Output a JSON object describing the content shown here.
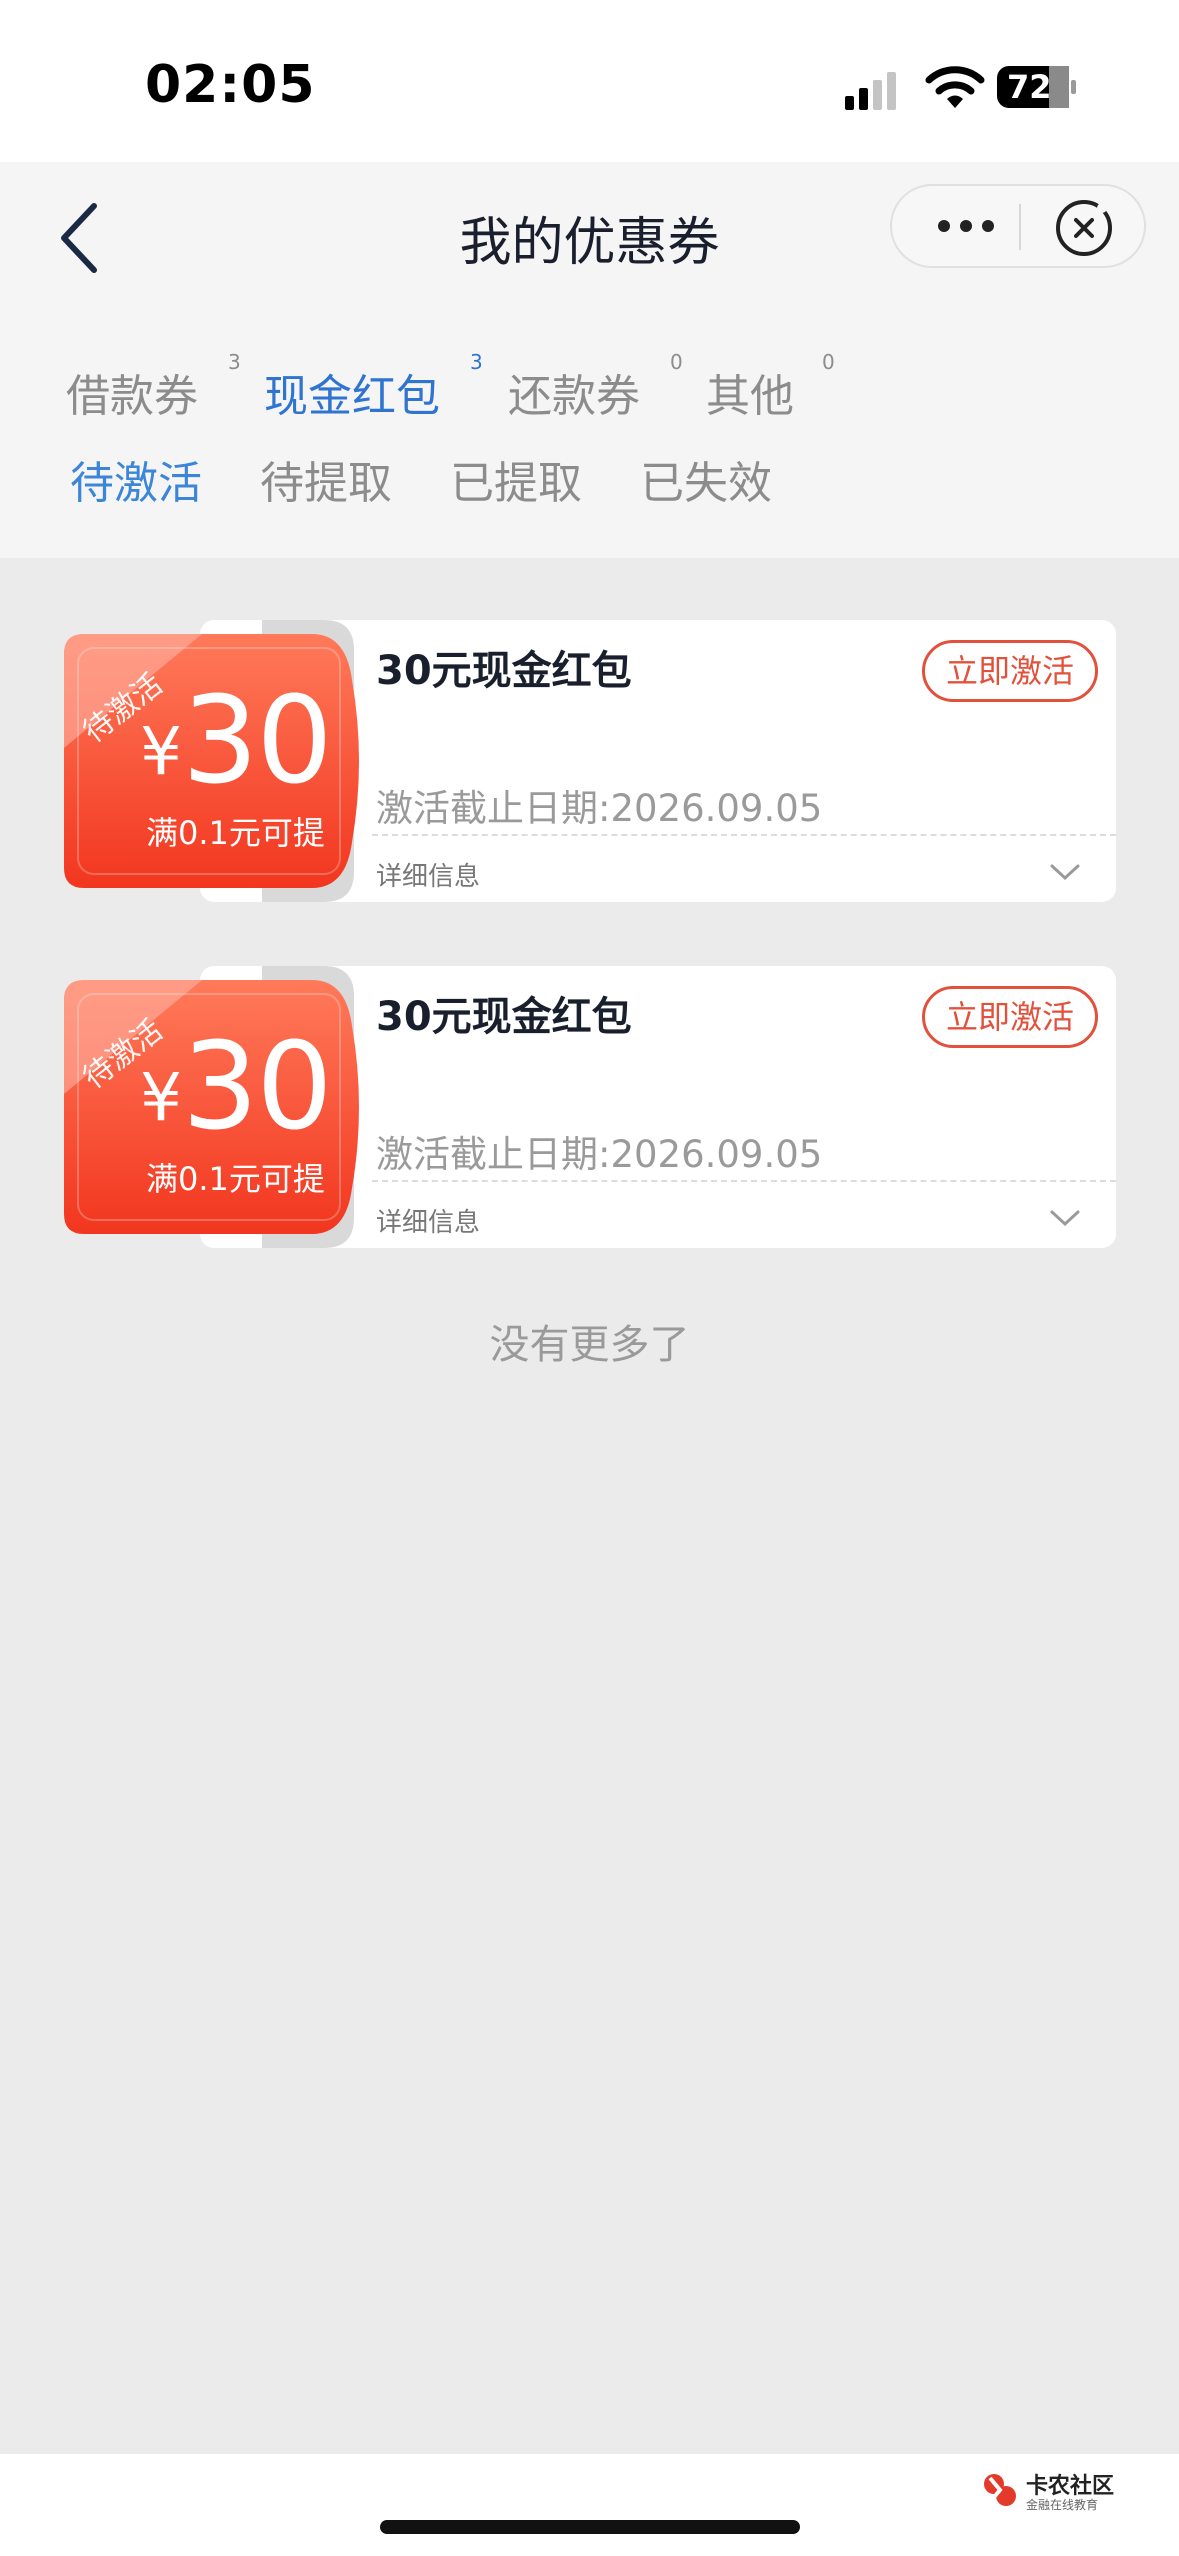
{
  "status": {
    "time": "02:05",
    "battery": "72"
  },
  "nav": {
    "title": "我的优惠券"
  },
  "tabs": [
    {
      "label": "借款券",
      "count": "3"
    },
    {
      "label": "现金红包",
      "count": "3"
    },
    {
      "label": "还款券",
      "count": "0"
    },
    {
      "label": "其他",
      "count": "0"
    }
  ],
  "subtabs": [
    "待激活",
    "待提取",
    "已提取",
    "已失效"
  ],
  "coupons": [
    {
      "tag": "待激活",
      "currency": "¥",
      "amount": "30",
      "condition": "满0.1元可提",
      "title": "30元现金红包",
      "action": "立即激活",
      "expiry": "激活截止日期:2026.09.05",
      "detail": "详细信息"
    },
    {
      "tag": "待激活",
      "currency": "¥",
      "amount": "30",
      "condition": "满0.1元可提",
      "title": "30元现金红包",
      "action": "立即激活",
      "expiry": "激活截止日期:2026.09.05",
      "detail": "详细信息"
    }
  ],
  "footer_text": "没有更多了",
  "watermark": {
    "name": "卡农社区",
    "sub": "金融在线教育"
  },
  "colors": {
    "active_tab": "#2f74d0",
    "coupon_red": "#f24a2e",
    "button_red": "#e2513b"
  }
}
